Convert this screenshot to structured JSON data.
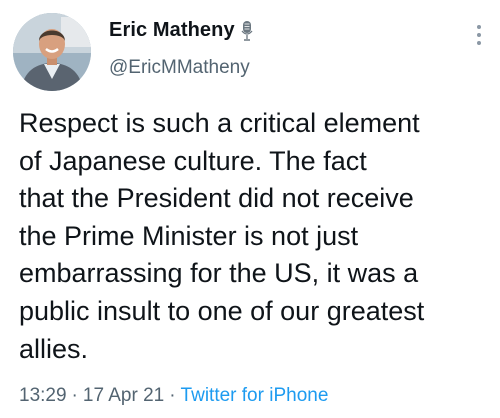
{
  "author": {
    "display_name": "Eric Matheny",
    "handle": "@EricMMatheny",
    "badge_icon": "microphone-icon",
    "avatar_icon": "user-avatar"
  },
  "tweet": {
    "text_lines": [
      "Respect is such a critical element",
      "of Japanese culture. The fact",
      "that the President did not receive",
      "the Prime Minister is not just",
      "embarrassing for the US, it was a",
      "public insult to one of our greatest",
      "allies."
    ],
    "time": "13:29",
    "date": "17 Apr 21",
    "separator": "·",
    "source": "Twitter for iPhone"
  },
  "menu": {
    "icon": "more-vertical-icon"
  },
  "colors": {
    "text": "#0f1419",
    "secondary": "#536471",
    "link": "#1d9bf0"
  }
}
